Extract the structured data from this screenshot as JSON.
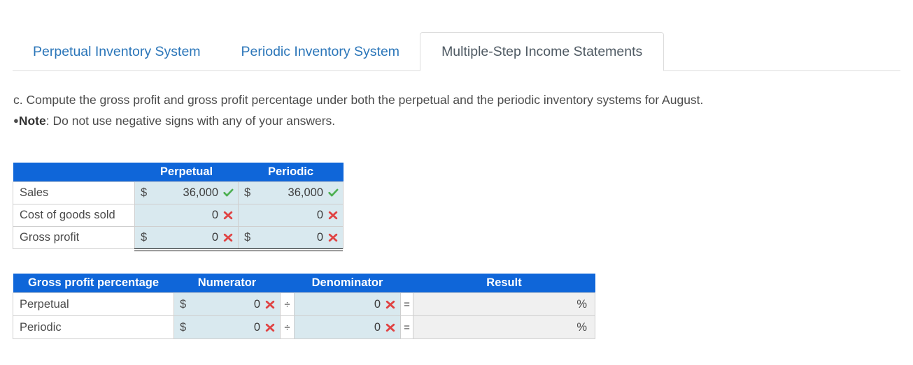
{
  "tabs": [
    {
      "label": "Perpetual Inventory System",
      "active": false
    },
    {
      "label": "Periodic Inventory System",
      "active": false
    },
    {
      "label": "Multiple-Step Income Statements",
      "active": true
    }
  ],
  "prompt": {
    "line1": "c. Compute the gross profit and gross profit percentage under both the perpetual and the periodic inventory systems for August.",
    "bullet": "●",
    "note_label": "Note",
    "note_text": ": Do not use negative signs with any of your answers."
  },
  "colors": {
    "header_blue": "#0f66d9",
    "input_fill": "#d9e9ef",
    "readonly_fill": "#f0f0f0",
    "correct_green": "#4caf50",
    "incorrect_red": "#e04343",
    "tab_link_blue": "#2b76b9"
  },
  "gross_profit_table": {
    "columns": [
      "",
      "Perpetual",
      "Periodic"
    ],
    "rows": [
      {
        "label": "Sales",
        "perpetual": {
          "currency": "$",
          "value": "36,000",
          "mark": "check"
        },
        "periodic": {
          "currency": "$",
          "value": "36,000",
          "mark": "check"
        }
      },
      {
        "label": "Cost of goods sold",
        "perpetual": {
          "currency": "",
          "value": "0",
          "mark": "cross"
        },
        "periodic": {
          "currency": "",
          "value": "0",
          "mark": "cross"
        }
      },
      {
        "label": "Gross profit",
        "perpetual": {
          "currency": "$",
          "value": "0",
          "mark": "cross"
        },
        "periodic": {
          "currency": "$",
          "value": "0",
          "mark": "cross"
        }
      }
    ]
  },
  "percentage_table": {
    "columns": [
      "Gross profit percentage",
      "Numerator",
      "Denominator",
      "Result"
    ],
    "operators": {
      "divide": "÷",
      "equals": "="
    },
    "percent_symbol": "%",
    "rows": [
      {
        "label": "Perpetual",
        "numerator": {
          "currency": "$",
          "value": "0",
          "mark": "cross"
        },
        "denominator": {
          "currency": "",
          "value": "0",
          "mark": "cross"
        },
        "result": ""
      },
      {
        "label": "Periodic",
        "numerator": {
          "currency": "$",
          "value": "0",
          "mark": "cross"
        },
        "denominator": {
          "currency": "",
          "value": "0",
          "mark": "cross"
        },
        "result": ""
      }
    ]
  }
}
